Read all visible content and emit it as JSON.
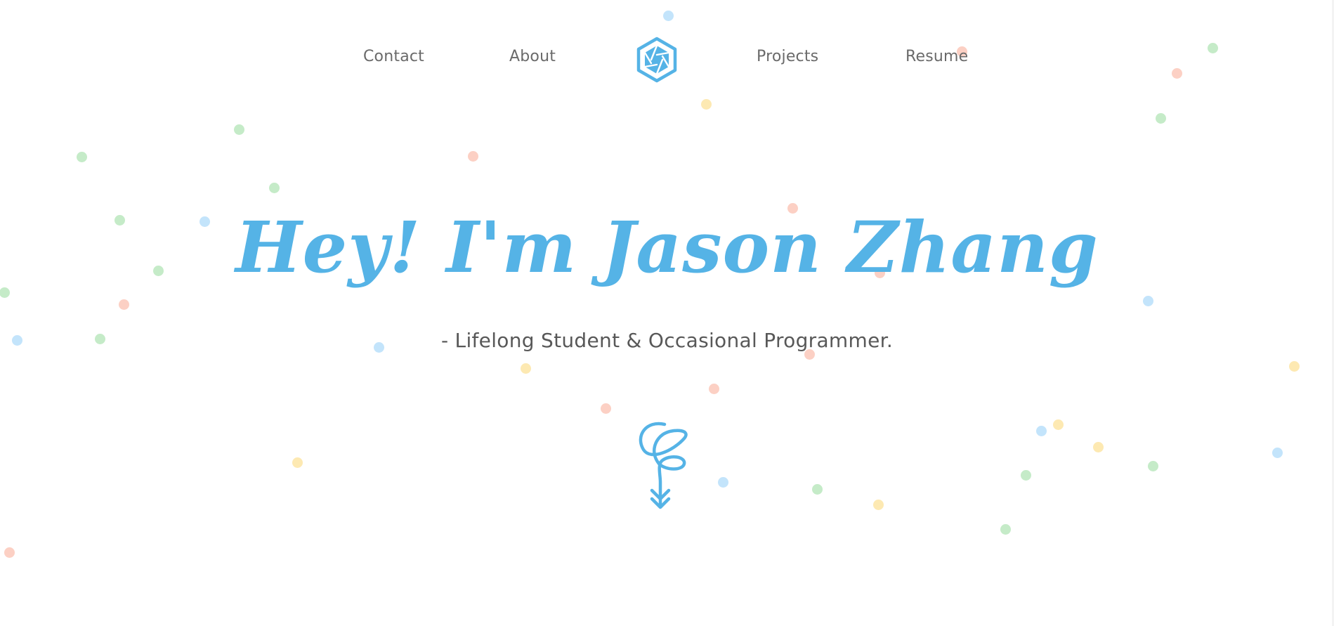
{
  "nav": {
    "left_links": [
      {
        "label": "Contact"
      },
      {
        "label": "About"
      }
    ],
    "right_links": [
      {
        "label": "Projects"
      },
      {
        "label": "Resume"
      }
    ],
    "logo_icon": "hexagon-aperture-logo-icon"
  },
  "hero": {
    "title": "Hey! I'm Jason Zhang",
    "subtitle": "- Lifelong Student & Occasional Programmer.",
    "scroll_icon": "curly-down-arrow-icon"
  },
  "colors": {
    "accent_blue": "#55b3e6",
    "text_gray": "#585858",
    "dot_blue": "#c3e4fb",
    "dot_green": "#c5ebc8",
    "dot_red": "#fcd0c4",
    "dot_yellow": "#fde9b2"
  }
}
